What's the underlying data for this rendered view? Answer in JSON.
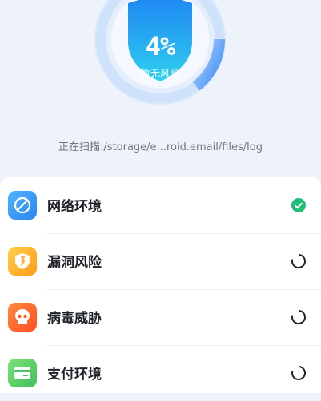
{
  "scan": {
    "percent_text": "4%",
    "percent_value": 4,
    "risk_text": "暂无风险",
    "current_path": "正在扫描:/storage/e...roid.email/files/log"
  },
  "checks": [
    {
      "label": "网络环境",
      "icon": "network-icon",
      "status": "done"
    },
    {
      "label": "漏洞风险",
      "icon": "vulnerability-shield-icon",
      "status": "loading"
    },
    {
      "label": "病毒威胁",
      "icon": "virus-skull-icon",
      "status": "loading"
    },
    {
      "label": "支付环境",
      "icon": "wallet-card-icon",
      "status": "loading"
    }
  ],
  "colors": {
    "accent_blue": "#3b8cf6",
    "success_green": "#1fbf75",
    "icon_network": "#3aa0f5",
    "icon_vulnerability": "#ffb41f",
    "icon_virus": "#ff6a2b",
    "icon_payment": "#5ccf6a"
  }
}
